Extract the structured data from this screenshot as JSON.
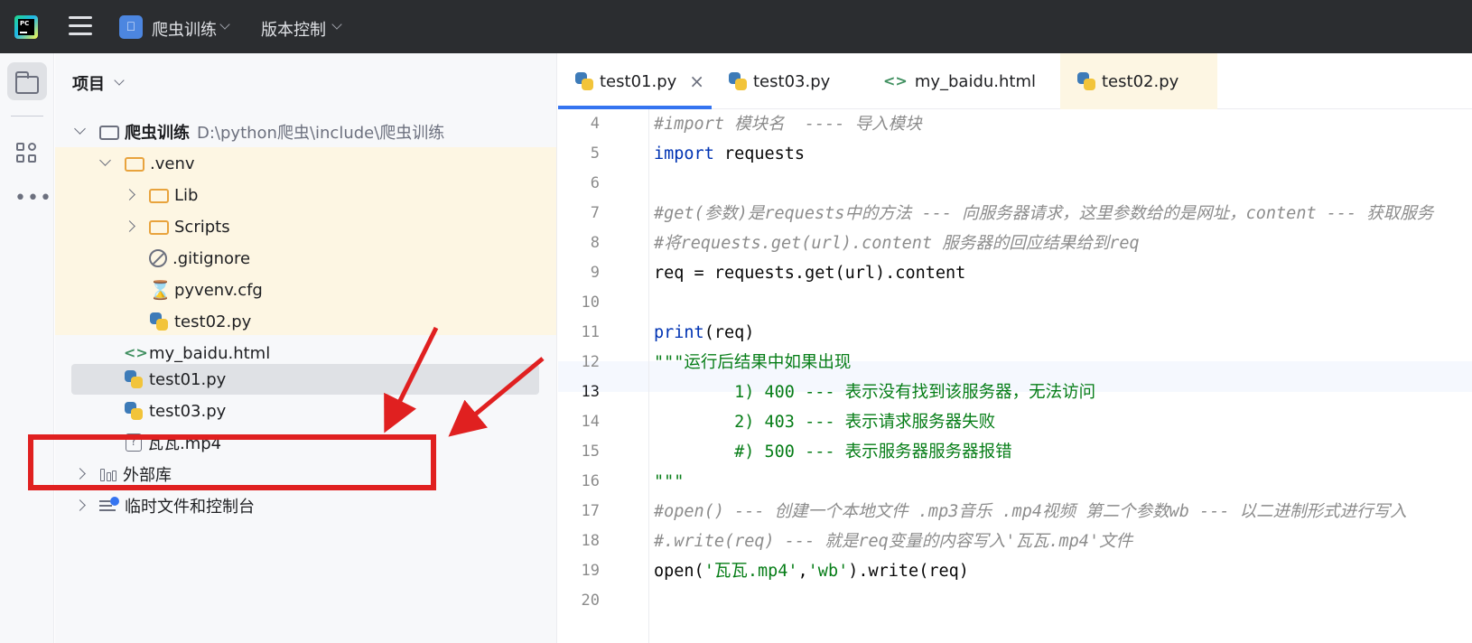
{
  "titlebar": {
    "logo_text": "PC",
    "project_name": "爬虫训练",
    "vcs": "版本控制"
  },
  "project_panel": {
    "title": "项目",
    "tree": {
      "root": {
        "name": "爬虫训练",
        "path": "D:\\python爬虫\\include\\爬虫训练"
      },
      "venv": ".venv",
      "lib": "Lib",
      "scripts": "Scripts",
      "gitignore": ".gitignore",
      "pyvenv": "pyvenv.cfg",
      "test02": "test02.py",
      "my_baidu": "my_baidu.html",
      "test01": "test01.py",
      "test03": "test03.py",
      "mp4": "瓦瓦.mp4",
      "external": "外部库",
      "scratch": "临时文件和控制台"
    }
  },
  "editor": {
    "tabs": [
      {
        "label": "test01.py",
        "icon": "python-icon",
        "active": true
      },
      {
        "label": "test03.py",
        "icon": "python-icon",
        "active": false
      },
      {
        "label": "my_baidu.html",
        "icon": "html-icon",
        "active": false
      },
      {
        "label": "test02.py",
        "icon": "python-icon",
        "active": false
      }
    ],
    "tab_close": "×",
    "current_line": 13,
    "lines": [
      {
        "n": "4",
        "parts": [
          {
            "t": "#import 模块名  ---- 导入模块",
            "c": "cmt"
          }
        ]
      },
      {
        "n": "5",
        "parts": [
          {
            "t": "import",
            "c": "kw"
          },
          {
            "t": " requests",
            "c": ""
          }
        ]
      },
      {
        "n": "6",
        "parts": []
      },
      {
        "n": "7",
        "parts": [
          {
            "t": "#get(参数)是requests中的方法 --- 向服务器请求，这里参数给的是网址，content --- 获取服务",
            "c": "cmt"
          }
        ]
      },
      {
        "n": "8",
        "parts": [
          {
            "t": "#将requests.get(url).content 服务器的回应结果给到req",
            "c": "cmt"
          }
        ]
      },
      {
        "n": "9",
        "parts": [
          {
            "t": "req = requests.get(url).content",
            "c": ""
          }
        ]
      },
      {
        "n": "10",
        "parts": []
      },
      {
        "n": "11",
        "parts": [
          {
            "t": "print",
            "c": "kw"
          },
          {
            "t": "(req)",
            "c": ""
          }
        ]
      },
      {
        "n": "12",
        "parts": [
          {
            "t": "\"\"\"运行后结果中如果出现",
            "c": "str"
          }
        ]
      },
      {
        "n": "13",
        "parts": [
          {
            "t": "        1) 400 --- 表示没有找到该服务器，无法访问",
            "c": "str"
          }
        ]
      },
      {
        "n": "14",
        "parts": [
          {
            "t": "        2) 403 --- 表示请求服务器失败",
            "c": "str"
          }
        ]
      },
      {
        "n": "15",
        "parts": [
          {
            "t": "        #) 500 --- 表示服务器服务器报错",
            "c": "str"
          }
        ]
      },
      {
        "n": "16",
        "parts": [
          {
            "t": "\"\"\"",
            "c": "str"
          }
        ]
      },
      {
        "n": "17",
        "parts": [
          {
            "t": "#open() --- 创建一个本地文件 .mp3音乐 .mp4视频 第二个参数wb --- 以二进制形式进行写入",
            "c": "cmt"
          }
        ]
      },
      {
        "n": "18",
        "parts": [
          {
            "t": "#.write(req) --- 就是req变量的内容写入'瓦瓦.mp4'文件",
            "c": "cmt"
          }
        ]
      },
      {
        "n": "19",
        "parts": [
          {
            "t": "open(",
            "c": ""
          },
          {
            "t": "'瓦瓦.mp4'",
            "c": "str"
          },
          {
            "t": ",",
            "c": ""
          },
          {
            "t": "'wb'",
            "c": "str"
          },
          {
            "t": ").write(req)",
            "c": ""
          }
        ]
      },
      {
        "n": "20",
        "parts": []
      }
    ]
  },
  "colors": {
    "annotation_red": "#e02020",
    "accent_blue": "#3574f0",
    "venv_highlight": "#fdf6e3"
  }
}
